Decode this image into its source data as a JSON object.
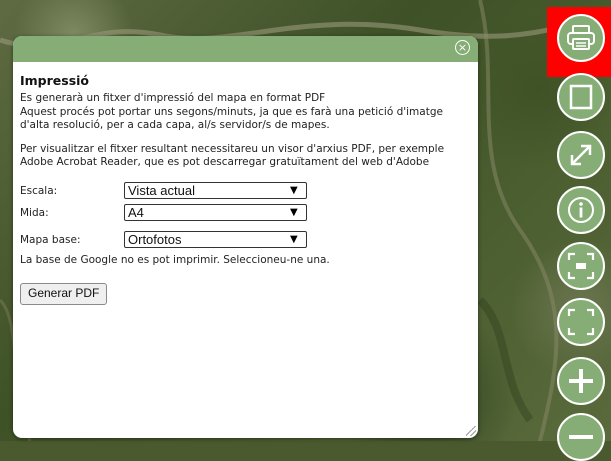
{
  "dialog": {
    "title": "Impressió",
    "close_icon": "close-icon",
    "intro_line1": "Es generarà un fitxer d'impressió del mapa en format PDF",
    "intro_line2": "Aquest procés pot portar uns segons/minuts, ja que es farà una petició d'imatge d'alta resolució, per a cada capa, al/s servidor/s de mapes.",
    "viewer_text": "Per visualitzar el fitxer resultant necessitareu un visor d'arxius PDF, per exemple Adobe Acrobat Reader, que es pot descarregar gratuïtament del web d'Adobe",
    "scale_label": "Escala:",
    "scale_value": "Vista actual",
    "size_label": "Mida:",
    "size_value": "A4",
    "basemap_label": "Mapa base:",
    "basemap_value": "Ortofotos",
    "google_note": "La base de Google no es pot imprimir. Seleccioneu-ne una.",
    "generate_label": "Generar PDF"
  },
  "toolbar": {
    "items": [
      {
        "name": "print-icon",
        "active": true
      },
      {
        "name": "square-frame-icon"
      },
      {
        "name": "fullscreen-arrow-icon"
      },
      {
        "name": "info-icon"
      },
      {
        "name": "zoom-extent-minus-icon"
      },
      {
        "name": "zoom-extent-icon"
      },
      {
        "name": "zoom-in-icon"
      },
      {
        "name": "zoom-out-icon"
      }
    ]
  },
  "colors": {
    "accent_green": "#86ad76",
    "active_highlight": "#ff0000"
  }
}
